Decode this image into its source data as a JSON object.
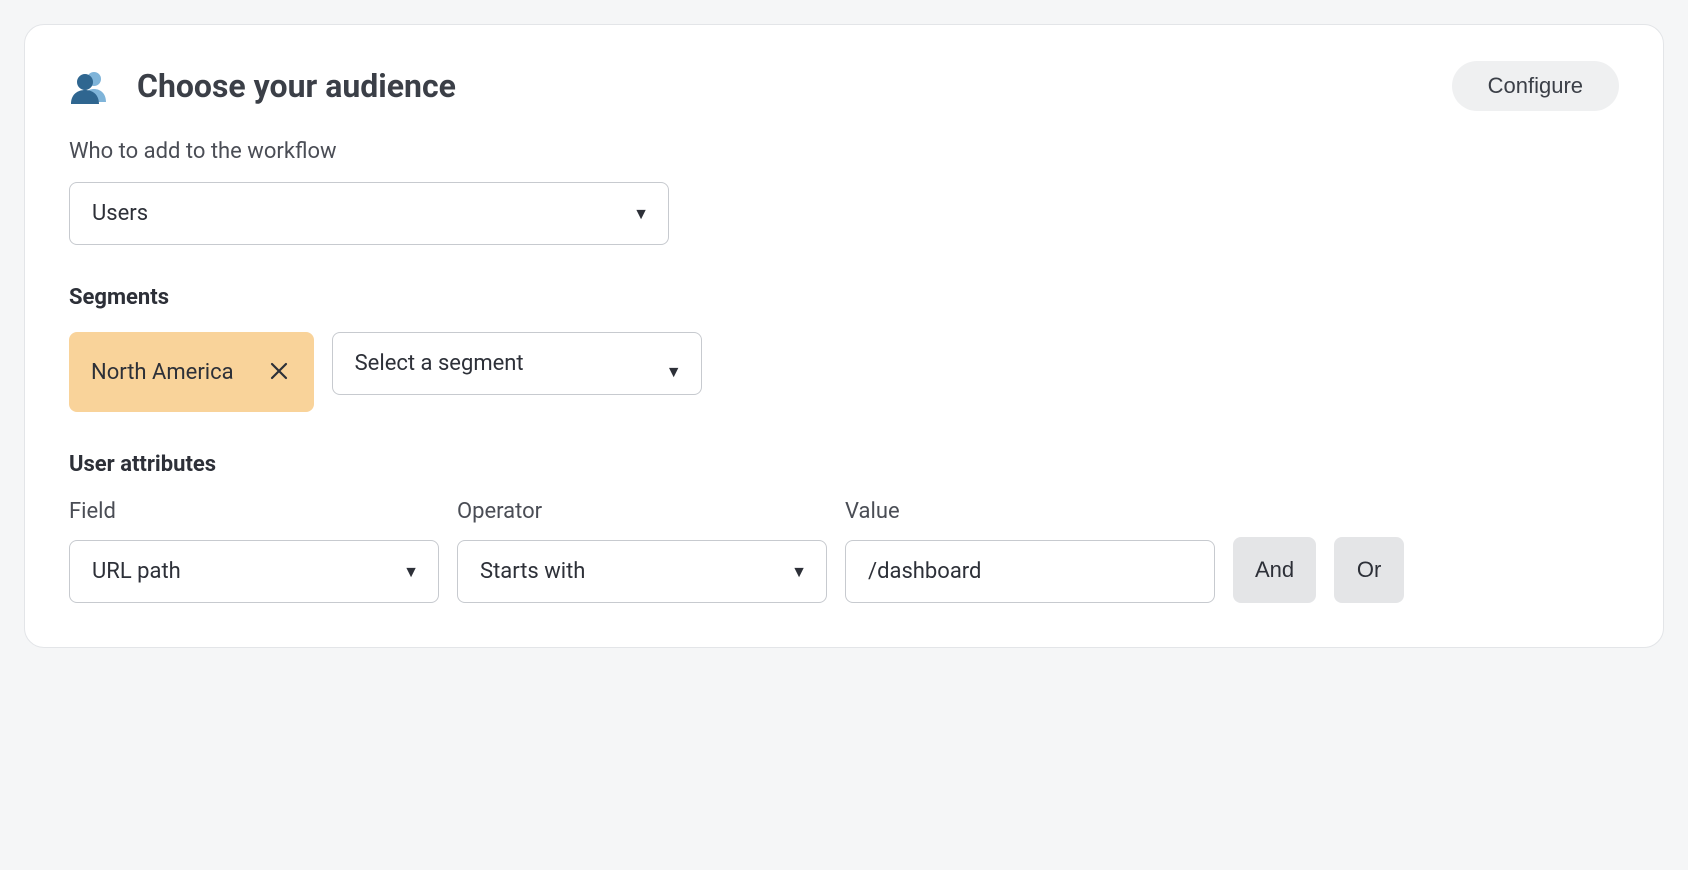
{
  "header": {
    "title": "Choose your audience",
    "configure_label": "Configure"
  },
  "workflow": {
    "label": "Who to add to the workflow",
    "selected": "Users"
  },
  "segments": {
    "heading": "Segments",
    "chips": [
      {
        "label": "North America"
      }
    ],
    "select_placeholder": "Select a segment"
  },
  "attributes": {
    "heading": "User attributes",
    "field": {
      "label": "Field",
      "value": "URL path"
    },
    "operator": {
      "label": "Operator",
      "value": "Starts with"
    },
    "value": {
      "label": "Value",
      "value": "/dashboard"
    },
    "logic": {
      "and_label": "And",
      "or_label": "Or"
    }
  },
  "icons": {
    "people": "people-icon",
    "close": "close-icon",
    "caret": "caret-down-icon"
  }
}
